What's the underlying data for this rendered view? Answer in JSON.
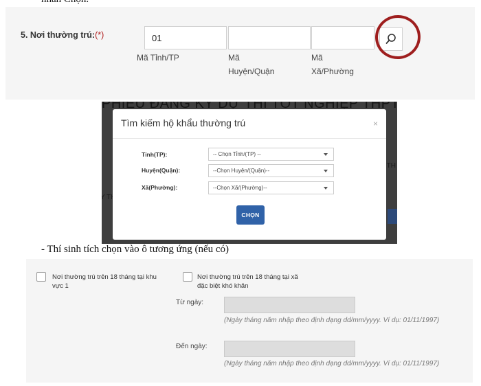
{
  "doc": {
    "top_fragment": "nhấn Chọn.",
    "mid_line": "- Thí sinh tích chọn vào ô tương ứng (nếu có)"
  },
  "residence": {
    "label": "5. Nơi thường trú:",
    "required_mark": "(*)",
    "province_code": "01",
    "district_code": "",
    "ward_code": "",
    "province_caption": "Mã Tỉnh/TP",
    "district_caption": "Mã Huyện/Quận",
    "ward_caption": "Mã Xã/Phường",
    "search_icon": "search-icon"
  },
  "background": {
    "heading": "PHIẾU ĐĂNG KÝ DỰ THI TỐT NGHIỆP THPT",
    "frag_left": "Y TH",
    "frag_right": "TH"
  },
  "modal": {
    "title": "Tìm kiếm hộ khẩu thường trú",
    "close": "×",
    "province_label": "Tỉnh(TP):",
    "province_value": "-- Chọn Tỉnh/(TP) --",
    "district_label": "Huyện(Quận):",
    "district_value": "--Chọn Huyện/(Quận)--",
    "ward_label": "Xã(Phường):",
    "ward_value": "--Chọn Xã/(Phường)--",
    "submit": "CHỌN",
    "accent": "#3062a8"
  },
  "options": {
    "checkbox1_label": "Nơi thường trú trên 18 tháng tại khu vực 1",
    "checkbox2_label": "Nơi thường trú trên 18 tháng tại xã đặc biệt khó khăn",
    "from_label": "Từ ngày:",
    "to_label": "Đến ngày:",
    "from_value": "",
    "to_value": "",
    "date_hint": "(Ngày tháng năm nhập theo định dạng dd/mm/yyyy. Ví dụ: 01/11/1997)"
  }
}
